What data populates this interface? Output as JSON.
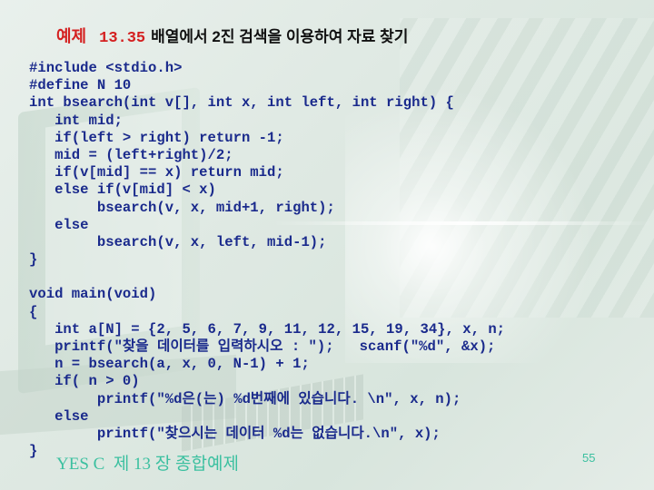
{
  "title": {
    "label": "예제",
    "number": "13.35",
    "text": "배열에서 2진 검색을 이용하여 자료 찾기"
  },
  "code": {
    "lines": [
      "#include <stdio.h>",
      "#define N 10",
      "int bsearch(int v[], int x, int left, int right) {",
      "   int mid;",
      "   if(left > right) return -1;",
      "   mid = (left+right)/2;",
      "   if(v[mid] == x) return mid;",
      "   else if(v[mid] < x)",
      "        bsearch(v, x, mid+1, right);",
      "   else",
      "        bsearch(v, x, left, mid-1);",
      "}",
      "",
      "void main(void)",
      "{",
      "   int a[N] = {2, 5, 6, 7, 9, 11, 12, 15, 19, 34}, x, n;",
      "   printf(\"찾을 데이터를 입력하시오 : \");   scanf(\"%d\", &x);",
      "   n = bsearch(a, x, 0, N-1) + 1;",
      "   if( n > 0)",
      "        printf(\"%d은(는) %d번째에 있습니다. \\n\", x, n);",
      "   else",
      "        printf(\"찾으시는 데이터 %d는 없습니다.\\n\", x);",
      "}"
    ]
  },
  "footer": {
    "text": "YES C  제 13 장 종합예제",
    "page": "55"
  },
  "colors": {
    "title_accent": "#d42020",
    "code": "#1a2a8c",
    "footer": "#3cc0a0"
  }
}
